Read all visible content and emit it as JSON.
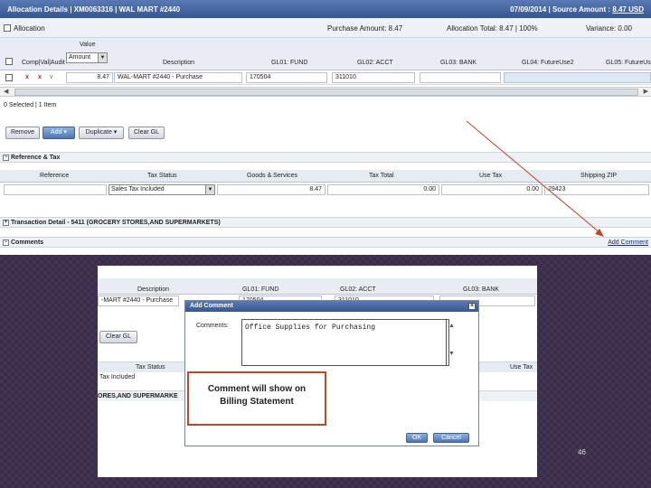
{
  "top": {
    "title_left": "Allocation Details | XM0063316 | WAL MART #2440",
    "title_right_prefix": "07/09/2014 | Source Amount : ",
    "title_right_amount": "8.47 USD",
    "allocation_label": "Allocation",
    "purchase_amount": "Purchase Amount: 8.47",
    "allocation_total": "Allocation Total: 8.47 | 100%",
    "variance": "Variance: 0.00",
    "grid": {
      "col_value": "Value",
      "value_select": "Amount",
      "col_comp": "Comp|Val|Audit",
      "col_description": "Description",
      "col_gl01": "GL01: FUND",
      "col_gl02": "GL02: ACCT",
      "col_gl03": "GL03: BANK",
      "col_gl04": "GL04: FutureUse2",
      "col_gl05": "GL05: FutureUs",
      "row": {
        "flags": [
          "x",
          "x",
          "v"
        ],
        "amount": "8.47",
        "description": "WAL-MART #2440 - Purchase",
        "gl01": "170504",
        "gl02": "311010",
        "gl03": ""
      }
    },
    "selected_text": "0 Selected | 1 Item",
    "buttons": {
      "remove": "Remove",
      "add": "Add ▾",
      "duplicate": "Duplicate ▾",
      "clear_gl": "Clear GL"
    },
    "reference_section": "Reference & Tax",
    "ref": {
      "col_reference": "Reference",
      "col_tax_status": "Tax Status",
      "col_goods": "Goods & Services",
      "col_tax_total": "Tax Total",
      "col_use_tax": "Use Tax",
      "col_ship_zip": "Shipping ZIP",
      "tax_status": "Sales Tax Included",
      "goods": "8.47",
      "tax_total": "0.00",
      "use_tax": "0.00",
      "ship_zip": "29423"
    },
    "transaction_section": "Transaction Detail - 5411 (GROCERY STORES,AND SUPERMARKETS)",
    "comments_section": "Comments",
    "add_comment_link": "Add Comment"
  },
  "bottom": {
    "col_description": "Description",
    "col_gl01": "GL01: FUND",
    "col_gl02": "GL02: ACCT",
    "col_gl03": "GL03: BANK",
    "row_description": "-MART #2440 - Purchase",
    "row_gl01": "170504",
    "row_gl02": "311010",
    "clear_gl": "Clear GL",
    "tax_status_head": "Tax Status",
    "use_tax_head": "Use Tax",
    "tax_included": "Tax Included",
    "stores_text": "ORES,AND SUPERMARKE",
    "dialog": {
      "title": "Add Comment",
      "comments_label": "Comments:",
      "comment_text": "Office Supplies for Purchasing",
      "ok": "OK",
      "cancel": "Cancel"
    },
    "callout_line1": "Comment will show on",
    "callout_line2": "Billing Statement"
  },
  "page_number": "46",
  "colors": {
    "background": "#3a2d4a",
    "title_bar": "#35568f",
    "arrow": "#c0452b",
    "callout_border": "#c0452b"
  }
}
